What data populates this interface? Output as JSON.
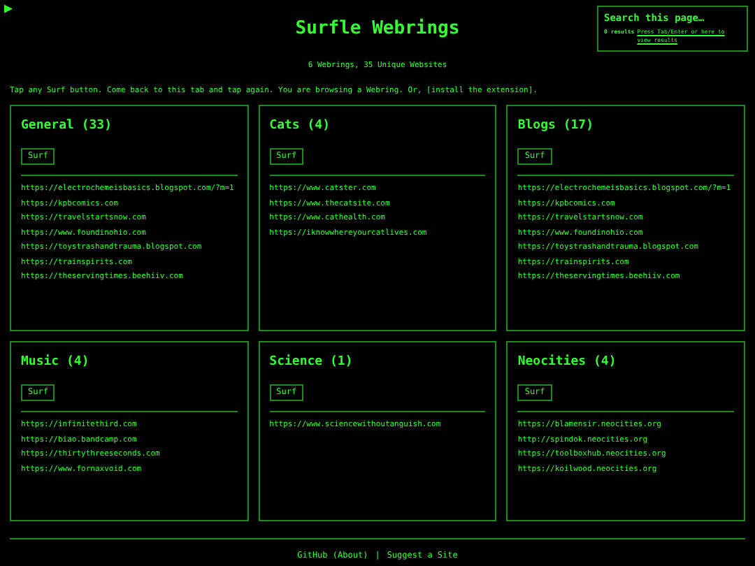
{
  "play_symbol": "▶",
  "title": "Surfle Webrings",
  "search": {
    "placeholder": "Search this page…",
    "results": "0 results",
    "hint_link": "Press Tab/Enter or here to view results"
  },
  "summary": "6 Webrings, 35 Unique Websites",
  "instructions": "Tap any Surf button. Come back to this tab and tap again. You are browsing a Webring. Or, [install the extension].",
  "webrings": [
    {
      "title": "General (33)",
      "button": "Surf",
      "sites": [
        "https://electrochemeisbasics.blogspot.com/?m=1",
        "https://kpbcomics.com",
        "https://travelstartsnow.com",
        "https://www.foundinohio.com",
        "https://toystrashandtrauma.blogspot.com",
        "https://trainspirits.com",
        "https://theservingtimes.beehiiv.com"
      ]
    },
    {
      "title": "Cats (4)",
      "button": "Surf",
      "sites": [
        "https://www.catster.com",
        "https://www.thecatsite.com",
        "https://www.cathealth.com",
        "https://iknowwhereyourcatlives.com"
      ]
    },
    {
      "title": "Blogs (17)",
      "button": "Surf",
      "sites": [
        "https://electrochemeisbasics.blogspot.com/?m=1",
        "https://kpbcomics.com",
        "https://travelstartsnow.com",
        "https://www.foundinohio.com",
        "https://toystrashandtrauma.blogspot.com",
        "https://trainspirits.com",
        "https://theservingtimes.beehiiv.com"
      ]
    },
    {
      "title": "Music (4)",
      "button": "Surf",
      "sites": [
        "https://infinitethird.com",
        "https://biao.bandcamp.com",
        "https://thirtythreeseconds.com",
        "https://www.fornaxvoid.com"
      ]
    },
    {
      "title": "Science (1)",
      "button": "Surf",
      "sites": [
        "https://www.sciencewithoutanguish.com"
      ]
    },
    {
      "title": "Neocities (4)",
      "button": "Surf",
      "sites": [
        "https://blamensir.neocities.org",
        "http://spindok.neocities.org",
        "https://toolboxhub.neocities.org",
        "https://koilwood.neocities.org"
      ]
    }
  ],
  "footer": {
    "links": [
      "GitHub (About)",
      "Suggest a Site"
    ],
    "separator": "|"
  }
}
